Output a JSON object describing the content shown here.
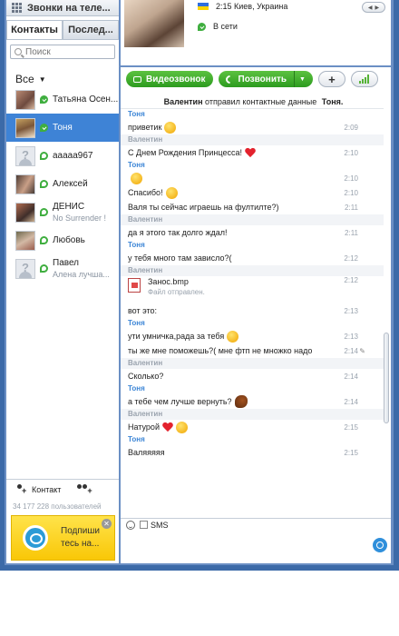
{
  "left": {
    "top_label": "Звонки на теле...",
    "tabs": [
      "Контакты",
      "Послед..."
    ],
    "search_placeholder": "Поиск",
    "filter_label": "Все",
    "contacts": [
      {
        "name": "Татьяна Осен...",
        "mood": "",
        "status": "online",
        "avatar": "photo"
      },
      {
        "name": "Тоня",
        "mood": "",
        "status": "online",
        "avatar": "photo2"
      },
      {
        "name": "ааааа967",
        "mood": "",
        "status": "offline",
        "avatar": "placeholder"
      },
      {
        "name": "Алексей",
        "mood": "",
        "status": "offline",
        "avatar": "photo3"
      },
      {
        "name": "ДЕНИС",
        "mood": "No Surrender !",
        "status": "offline",
        "avatar": "photo4"
      },
      {
        "name": "Любовь",
        "mood": "",
        "status": "offline",
        "avatar": "photo5"
      },
      {
        "name": "Павел",
        "mood": "Алена лучша...",
        "status": "offline",
        "avatar": "placeholder"
      }
    ],
    "add_contact_label": "Контакт",
    "user_count": "34 177 228 пользователей",
    "promo_text_line1": "Подпиши",
    "promo_text_line2": "тесь на..."
  },
  "profile": {
    "location": "2:15 Киев, Украина",
    "status": "В сети"
  },
  "toolbar": {
    "video_call": "Видеозвонок",
    "call": "Позвонить",
    "add": "+"
  },
  "chat": {
    "system_msg_sender": "Валентин",
    "system_msg_text": "отправил контактные данные",
    "system_msg_target": "Тоня.",
    "file": {
      "name": "Занос.bmp",
      "status": "Файл отправлен.",
      "time": "2:12"
    },
    "messages": [
      {
        "sender": "Тоня",
        "text": "приветик",
        "time": "2:09"
      },
      {
        "sender": "Валентин",
        "text": "С Днем Рождения Принцесса!",
        "time": "2:10"
      },
      {
        "sender": "Тоня",
        "text": "",
        "time": "2:10"
      },
      {
        "sender": "",
        "text": "Спасибо!",
        "time": "2:10"
      },
      {
        "sender": "",
        "text": "Валя ты сейчас играешь на фултилте?)",
        "time": "2:11"
      },
      {
        "sender": "Валентин",
        "text": "да я этого так долго ждал!",
        "time": "2:11"
      },
      {
        "sender": "Тоня",
        "text": "у тебя много там зависло?(",
        "time": "2:12"
      },
      {
        "sender": "Валентин",
        "text": "",
        "time": ""
      },
      {
        "sender": "",
        "text": "вот это:",
        "time": "2:13"
      },
      {
        "sender": "Тоня",
        "text": "ути умничка,рада за тебя",
        "time": "2:13"
      },
      {
        "sender": "",
        "text": "ты же мне поможешь?( мне фтп не множко надо",
        "time": "2:14"
      },
      {
        "sender": "Валентин",
        "text": "Сколько?",
        "time": "2:14"
      },
      {
        "sender": "Тоня",
        "text": "а тебе чем лучше вернуть?",
        "time": "2:14"
      },
      {
        "sender": "Валентин",
        "text": "Натурой",
        "time": "2:15"
      },
      {
        "sender": "Тоня",
        "text": "Валяяяяя",
        "time": "2:15"
      }
    ],
    "sms_label": "SMS"
  }
}
